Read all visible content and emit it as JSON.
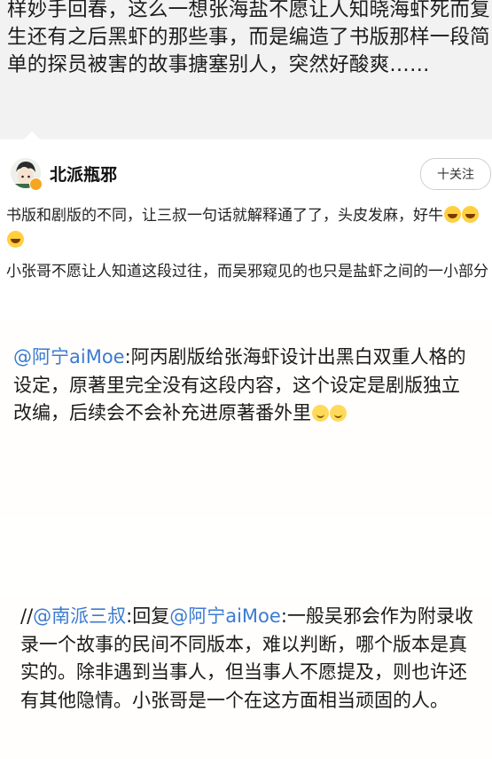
{
  "prev_comment": {
    "text": "样妙手回春，这么一想张海盐不愿让人知晓海虾死而复生还有之后黑虾的那些事，而是编造了书版那样一段简单的探员被害的故事搪塞别人，突然好酸爽……"
  },
  "post": {
    "username": "北派瓶邪",
    "follow_label": "十关注",
    "para1_text": "书版和剧版的不同，让三叔一句话就解释通了了，头皮发麻，好牛",
    "para2": "小张哥不愿让人知道这段过往，而吴邪窥见的也只是盐虾之间的一小部分"
  },
  "image": {
    "quote1": {
      "mention": "@阿宁aiMoe",
      "text": ":阿丙剧版给张海虾设计出黑白双重人格的设定，原著里完全没有这段内容，这个设定是剧版独立改编，后续会不会补充进原著番外里"
    },
    "quote2": {
      "prefix": "//",
      "mention1": "@南派三叔",
      "mid": ":回复",
      "mention2": "@阿宁aiMoe",
      "text": ":一般吴邪会作为附录收录一个故事的民间不同版本，难以判断，哪个版本是真实的。除非遇到当事人，但当事人不愿提及，则也许还有其他隐情。小张哥是一个在这方面相当顽固的人。"
    }
  }
}
